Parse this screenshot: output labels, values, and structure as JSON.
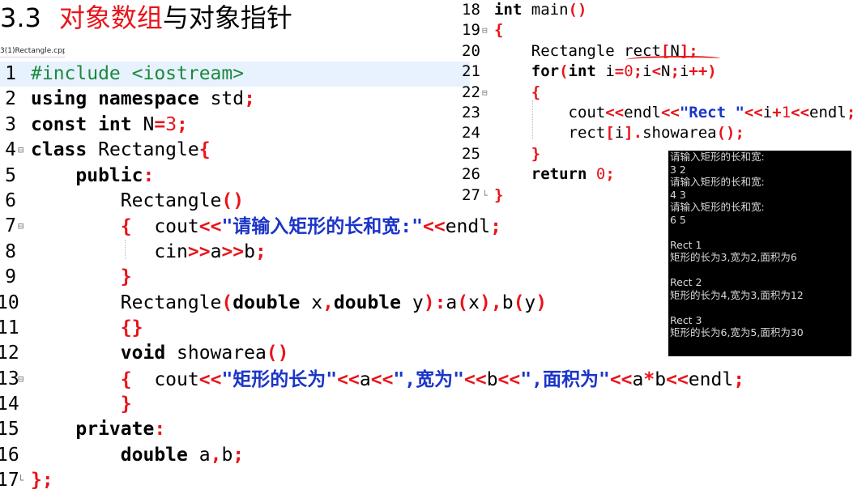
{
  "slide_title": {
    "number": "3.3",
    "highlight": "对象数组",
    "rest": "与对象指针"
  },
  "file_tab": "3(1)Rectangle.cpp",
  "left_code": [
    {
      "ln": "1",
      "fold": "",
      "tokens": [
        {
          "t": "#include <iostream>",
          "c": "pp"
        }
      ],
      "hl": true
    },
    {
      "ln": "2",
      "fold": "",
      "tokens": [
        {
          "t": "using namespace",
          "c": "kw"
        },
        {
          "t": " std"
        },
        {
          "t": ";",
          "c": "op"
        }
      ]
    },
    {
      "ln": "3",
      "fold": "",
      "tokens": [
        {
          "t": "const int",
          "c": "kw"
        },
        {
          "t": " N"
        },
        {
          "t": "=",
          "c": "op"
        },
        {
          "t": "3",
          "c": "numv"
        },
        {
          "t": ";",
          "c": "op"
        }
      ]
    },
    {
      "ln": "4",
      "fold": "⊟",
      "tokens": [
        {
          "t": "class",
          "c": "kw"
        },
        {
          "t": " Rectangle"
        },
        {
          "t": "{",
          "c": "op"
        }
      ]
    },
    {
      "ln": "5",
      "fold": "",
      "tokens": [
        {
          "t": "    "
        },
        {
          "t": "public",
          "c": "kw"
        },
        {
          "t": ":",
          "c": "op"
        }
      ]
    },
    {
      "ln": "6",
      "fold": "",
      "tokens": [
        {
          "t": "        Rectangle"
        },
        {
          "t": "()",
          "c": "op"
        }
      ]
    },
    {
      "ln": "7",
      "fold": "⊟",
      "tokens": [
        {
          "t": "        "
        },
        {
          "t": "{",
          "c": "op"
        },
        {
          "t": "  cout"
        },
        {
          "t": "<<",
          "c": "op"
        },
        {
          "t": "\"",
          "c": "str"
        },
        {
          "t": "请输入矩形的长和宽",
          "c": "str cn"
        },
        {
          "t": ":\"",
          "c": "str"
        },
        {
          "t": "<<",
          "c": "op"
        },
        {
          "t": "endl"
        },
        {
          "t": ";",
          "c": "op"
        }
      ]
    },
    {
      "ln": "8",
      "fold": "",
      "tokens": [
        {
          "t": "           cin"
        },
        {
          "t": ">>",
          "c": "op"
        },
        {
          "t": "a"
        },
        {
          "t": ">>",
          "c": "op"
        },
        {
          "t": "b"
        },
        {
          "t": ";",
          "c": "op"
        }
      ]
    },
    {
      "ln": "9",
      "fold": "",
      "tokens": [
        {
          "t": "        "
        },
        {
          "t": "}",
          "c": "op"
        }
      ]
    },
    {
      "ln": "10",
      "fold": "",
      "tokens": [
        {
          "t": "        Rectangle"
        },
        {
          "t": "(",
          "c": "op"
        },
        {
          "t": "double",
          "c": "kw"
        },
        {
          "t": " x"
        },
        {
          "t": ",",
          "c": "op"
        },
        {
          "t": "double",
          "c": "kw"
        },
        {
          "t": " y"
        },
        {
          "t": "):",
          "c": "op"
        },
        {
          "t": "a"
        },
        {
          "t": "(",
          "c": "op"
        },
        {
          "t": "x"
        },
        {
          "t": "),",
          "c": "op"
        },
        {
          "t": "b"
        },
        {
          "t": "(",
          "c": "op"
        },
        {
          "t": "y"
        },
        {
          "t": ")",
          "c": "op"
        }
      ]
    },
    {
      "ln": "11",
      "fold": "",
      "tokens": [
        {
          "t": "        "
        },
        {
          "t": "{}",
          "c": "op"
        }
      ]
    },
    {
      "ln": "12",
      "fold": "",
      "tokens": [
        {
          "t": "        "
        },
        {
          "t": "void",
          "c": "kw"
        },
        {
          "t": " showarea"
        },
        {
          "t": "()",
          "c": "op"
        }
      ]
    },
    {
      "ln": "13",
      "fold": "⊟",
      "tokens": [
        {
          "t": "        "
        },
        {
          "t": "{",
          "c": "op"
        },
        {
          "t": "  cout"
        },
        {
          "t": "<<",
          "c": "op"
        },
        {
          "t": "\"",
          "c": "str"
        },
        {
          "t": "矩形的长为",
          "c": "str cn"
        },
        {
          "t": "\"",
          "c": "str"
        },
        {
          "t": "<<",
          "c": "op"
        },
        {
          "t": "a"
        },
        {
          "t": "<<",
          "c": "op"
        },
        {
          "t": "\",",
          "c": "str"
        },
        {
          "t": "宽为",
          "c": "str cn"
        },
        {
          "t": "\"",
          "c": "str"
        },
        {
          "t": "<<",
          "c": "op"
        },
        {
          "t": "b"
        },
        {
          "t": "<<",
          "c": "op"
        },
        {
          "t": "\",",
          "c": "str"
        },
        {
          "t": "面积为",
          "c": "str cn"
        },
        {
          "t": "\"",
          "c": "str"
        },
        {
          "t": "<<",
          "c": "op"
        },
        {
          "t": "a"
        },
        {
          "t": "*",
          "c": "op"
        },
        {
          "t": "b"
        },
        {
          "t": "<<",
          "c": "op"
        },
        {
          "t": "endl"
        },
        {
          "t": ";",
          "c": "op"
        }
      ]
    },
    {
      "ln": "14",
      "fold": "",
      "tokens": [
        {
          "t": "        "
        },
        {
          "t": "}",
          "c": "op"
        }
      ]
    },
    {
      "ln": "15",
      "fold": "",
      "tokens": [
        {
          "t": "    "
        },
        {
          "t": "private",
          "c": "kw"
        },
        {
          "t": ":",
          "c": "op"
        }
      ]
    },
    {
      "ln": "16",
      "fold": "",
      "tokens": [
        {
          "t": "        "
        },
        {
          "t": "double",
          "c": "kw"
        },
        {
          "t": " a"
        },
        {
          "t": ",",
          "c": "op"
        },
        {
          "t": "b"
        },
        {
          "t": ";",
          "c": "op"
        }
      ]
    },
    {
      "ln": "17",
      "fold": "└",
      "tokens": [
        {
          "t": "};",
          "c": "op"
        }
      ]
    }
  ],
  "right_code": [
    {
      "ln": "18",
      "fold": "",
      "tokens": [
        {
          "t": "int",
          "c": "kw"
        },
        {
          "t": " main"
        },
        {
          "t": "()",
          "c": "op"
        }
      ]
    },
    {
      "ln": "19",
      "fold": "⊟",
      "tokens": [
        {
          "t": "{",
          "c": "op"
        }
      ]
    },
    {
      "ln": "20",
      "fold": "",
      "tokens": [
        {
          "t": "    Rectangle rect"
        },
        {
          "t": "[",
          "c": "op"
        },
        {
          "t": "N"
        },
        {
          "t": "];",
          "c": "op"
        }
      ]
    },
    {
      "ln": "21",
      "fold": "",
      "tokens": [
        {
          "t": "    "
        },
        {
          "t": "for",
          "c": "kw"
        },
        {
          "t": "(",
          "c": "op"
        },
        {
          "t": "int",
          "c": "kw"
        },
        {
          "t": " i"
        },
        {
          "t": "=",
          "c": "op"
        },
        {
          "t": "0",
          "c": "numv"
        },
        {
          "t": ";",
          "c": "op"
        },
        {
          "t": "i"
        },
        {
          "t": "<",
          "c": "op"
        },
        {
          "t": "N"
        },
        {
          "t": ";",
          "c": "op"
        },
        {
          "t": "i"
        },
        {
          "t": "++)",
          "c": "op"
        }
      ]
    },
    {
      "ln": "22",
      "fold": "⊟",
      "tokens": [
        {
          "t": "    "
        },
        {
          "t": "{",
          "c": "op"
        }
      ]
    },
    {
      "ln": "23",
      "fold": "",
      "tokens": [
        {
          "t": "        cout"
        },
        {
          "t": "<<",
          "c": "op"
        },
        {
          "t": "endl"
        },
        {
          "t": "<<",
          "c": "op"
        },
        {
          "t": "\"Rect \"",
          "c": "str"
        },
        {
          "t": "<<",
          "c": "op"
        },
        {
          "t": "i"
        },
        {
          "t": "+",
          "c": "op"
        },
        {
          "t": "1",
          "c": "numv"
        },
        {
          "t": "<<",
          "c": "op"
        },
        {
          "t": "endl"
        },
        {
          "t": ";",
          "c": "op"
        }
      ]
    },
    {
      "ln": "24",
      "fold": "",
      "tokens": [
        {
          "t": "        rect"
        },
        {
          "t": "[",
          "c": "op"
        },
        {
          "t": "i"
        },
        {
          "t": "].",
          "c": "op"
        },
        {
          "t": "showarea"
        },
        {
          "t": "();",
          "c": "op"
        }
      ]
    },
    {
      "ln": "25",
      "fold": "",
      "tokens": [
        {
          "t": "    "
        },
        {
          "t": "}",
          "c": "op"
        }
      ]
    },
    {
      "ln": "26",
      "fold": "",
      "tokens": [
        {
          "t": "    "
        },
        {
          "t": "return",
          "c": "kw"
        },
        {
          "t": " "
        },
        {
          "t": "0",
          "c": "numv"
        },
        {
          "t": ";",
          "c": "op"
        }
      ]
    },
    {
      "ln": "27",
      "fold": "└",
      "tokens": [
        {
          "t": "}",
          "c": "op"
        }
      ]
    }
  ],
  "console_lines": [
    "请输入矩形的长和宽:",
    "3 2",
    "请输入矩形的长和宽:",
    "4 3",
    "请输入矩形的长和宽:",
    "6 5",
    "",
    "Rect 1",
    "矩形的长为3,宽为2,面积为6",
    "",
    "Rect 2",
    "矩形的长为4,宽为3,面积为12",
    "",
    "Rect 3",
    "矩形的长为6,宽为5,面积为30"
  ],
  "colors": {
    "keyword": "#000000",
    "operator": "#e8141a",
    "string": "#1b35c8",
    "preprocessor": "#1b8a3c",
    "console_bg": "#000000"
  }
}
